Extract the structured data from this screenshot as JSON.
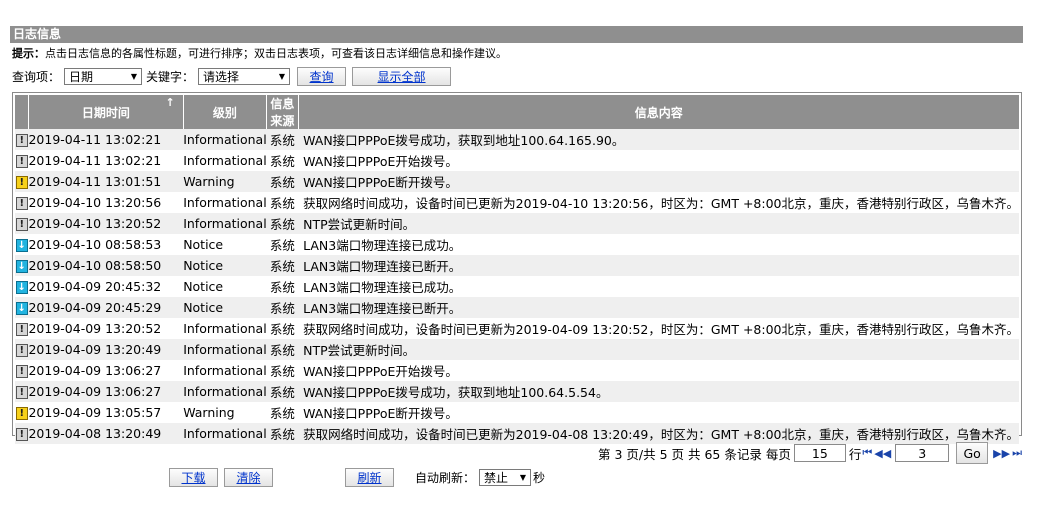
{
  "section_title": "日志信息",
  "hint": {
    "label": "提示：",
    "text": "点击日志信息的各属性标题，可进行排序；双击日志表项，可查看该日志详细信息和操作建议。"
  },
  "query": {
    "field_label": "查询项：",
    "field_value": "日期",
    "keyword_label": "关键字：",
    "keyword_value": "请选择",
    "search_button": "查询",
    "show_all_button": "显示全部"
  },
  "table": {
    "headers": {
      "datetime": "日期时间",
      "sort_icon": "↑",
      "level": "级别",
      "source": "信息来源",
      "content": "信息内容"
    },
    "rows": [
      {
        "icon": "info",
        "datetime": "2019-04-11 13:02:21",
        "level": "Informational",
        "source": "系统",
        "content": "WAN接口PPPoE拨号成功，获取到地址100.64.165.90。"
      },
      {
        "icon": "info",
        "datetime": "2019-04-11 13:02:21",
        "level": "Informational",
        "source": "系统",
        "content": "WAN接口PPPoE开始拨号。"
      },
      {
        "icon": "warning",
        "datetime": "2019-04-11 13:01:51",
        "level": "Warning",
        "source": "系统",
        "content": "WAN接口PPPoE断开拨号。"
      },
      {
        "icon": "info",
        "datetime": "2019-04-10 13:20:56",
        "level": "Informational",
        "source": "系统",
        "content": "获取网络时间成功，设备时间已更新为2019-04-10 13:20:56，时区为：GMT +8:00北京，重庆，香港特别行政区，乌鲁木齐。"
      },
      {
        "icon": "info",
        "datetime": "2019-04-10 13:20:52",
        "level": "Informational",
        "source": "系统",
        "content": "NTP尝试更新时间。"
      },
      {
        "icon": "notice",
        "datetime": "2019-04-10 08:58:53",
        "level": "Notice",
        "source": "系统",
        "content": "LAN3端口物理连接已成功。"
      },
      {
        "icon": "notice",
        "datetime": "2019-04-10 08:58:50",
        "level": "Notice",
        "source": "系统",
        "content": "LAN3端口物理连接已断开。"
      },
      {
        "icon": "notice",
        "datetime": "2019-04-09 20:45:32",
        "level": "Notice",
        "source": "系统",
        "content": "LAN3端口物理连接已成功。"
      },
      {
        "icon": "notice",
        "datetime": "2019-04-09 20:45:29",
        "level": "Notice",
        "source": "系统",
        "content": "LAN3端口物理连接已断开。"
      },
      {
        "icon": "info",
        "datetime": "2019-04-09 13:20:52",
        "level": "Informational",
        "source": "系统",
        "content": "获取网络时间成功，设备时间已更新为2019-04-09 13:20:52，时区为：GMT +8:00北京，重庆，香港特别行政区，乌鲁木齐。"
      },
      {
        "icon": "info",
        "datetime": "2019-04-09 13:20:49",
        "level": "Informational",
        "source": "系统",
        "content": "NTP尝试更新时间。"
      },
      {
        "icon": "info",
        "datetime": "2019-04-09 13:06:27",
        "level": "Informational",
        "source": "系统",
        "content": "WAN接口PPPoE开始拨号。"
      },
      {
        "icon": "info",
        "datetime": "2019-04-09 13:06:27",
        "level": "Informational",
        "source": "系统",
        "content": "WAN接口PPPoE拨号成功，获取到地址100.64.5.54。"
      },
      {
        "icon": "warning",
        "datetime": "2019-04-09 13:05:57",
        "level": "Warning",
        "source": "系统",
        "content": "WAN接口PPPoE断开拨号。"
      },
      {
        "icon": "info",
        "datetime": "2019-04-08 13:20:49",
        "level": "Informational",
        "source": "系统",
        "content": "获取网络时间成功，设备时间已更新为2019-04-08 13:20:49，时区为：GMT +8:00北京，重庆，香港特别行政区，乌鲁木齐。"
      }
    ]
  },
  "pager": {
    "text_prefix": "第 3 页/共 5 页 共 65 条记录 每页",
    "per_page": "15",
    "rows_label": "行",
    "page_input": "3",
    "go_button": "Go"
  },
  "actions": {
    "download_button": "下载",
    "clear_button": "清除",
    "refresh_button": "刷新",
    "auto_refresh_label": "自动刷新：",
    "auto_refresh_value": "禁止",
    "seconds_label": "秒"
  },
  "icons": {
    "info": "!",
    "warning": "!",
    "notice": "↓",
    "first": "⏮",
    "prev": "◀◀",
    "next": "▶▶",
    "last": "⏭"
  }
}
